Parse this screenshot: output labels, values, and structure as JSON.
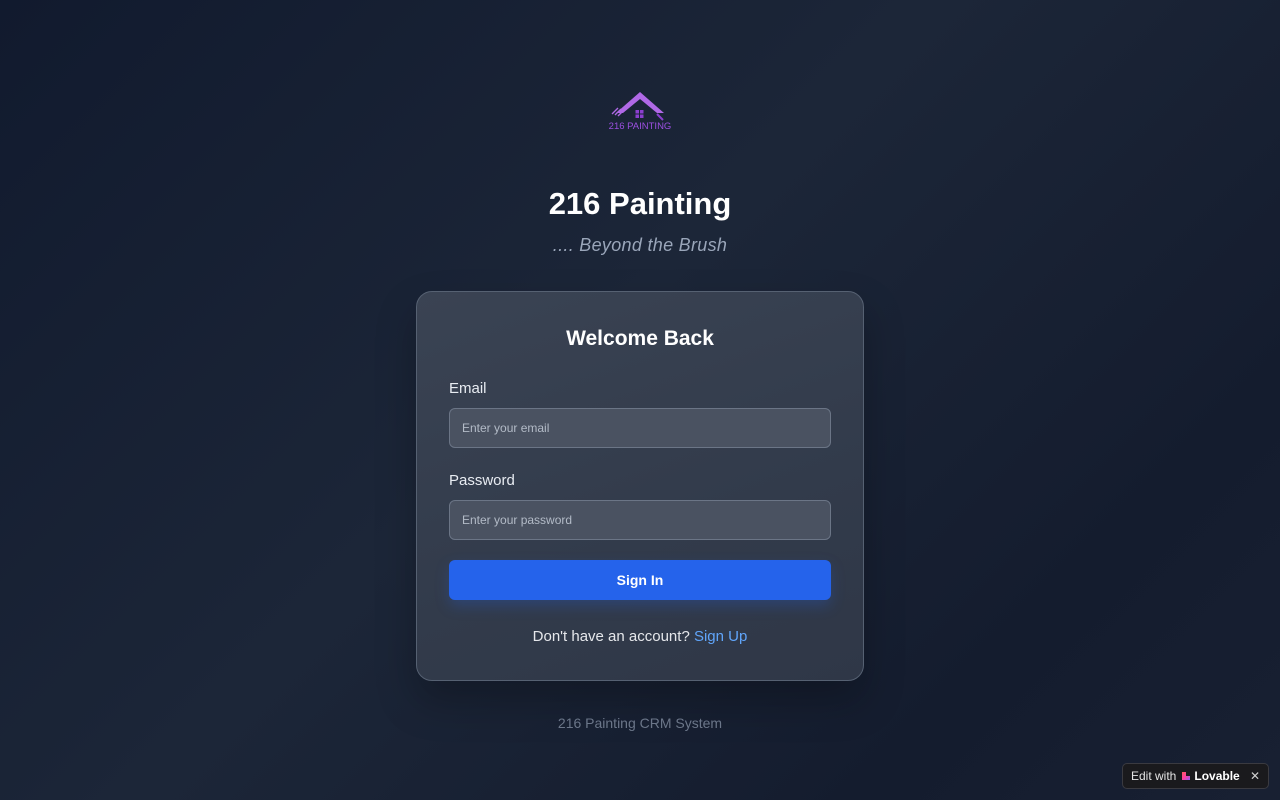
{
  "brand": {
    "logo_text": "216 PAINTING",
    "title": "216 Painting",
    "tagline": ".... Beyond the Brush"
  },
  "login_card": {
    "heading": "Welcome Back",
    "email": {
      "label": "Email",
      "placeholder": "Enter your email",
      "value": ""
    },
    "password": {
      "label": "Password",
      "placeholder": "Enter your password",
      "value": ""
    },
    "submit_label": "Sign In",
    "signup_prompt": "Don't have an account?",
    "signup_link": "Sign Up"
  },
  "footer": {
    "text": "216 Painting CRM System"
  },
  "lovable_badge": {
    "prefix": "Edit with",
    "brand": "Lovable",
    "close_glyph": "✕"
  },
  "colors": {
    "accent": "#2563eb",
    "link": "#60a5fa",
    "logo_purple": "#a855f7"
  },
  "icons": {
    "logo": "house-roof-paint-logo",
    "badge": "heart-icon",
    "close": "close-icon"
  }
}
